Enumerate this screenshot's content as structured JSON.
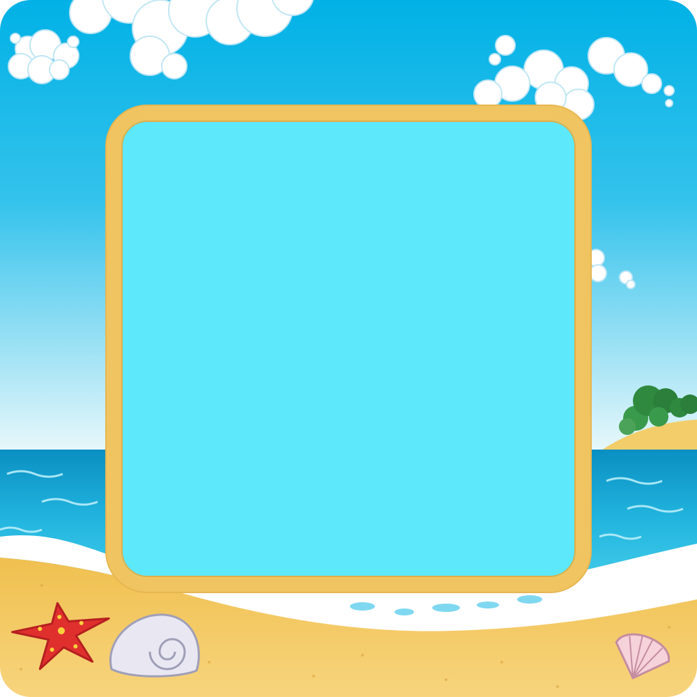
{
  "scene": {
    "theme": "cartoon beach photo frame",
    "colors": {
      "sky_top": "#01b1e6",
      "sky_bottom": "#e7f7fb",
      "sea": "#0fa6d4",
      "sand": "#f3c55d",
      "frame_border": "#f0c561",
      "frame_fill": "#5de8fc"
    },
    "icons": [
      "cloud-icon",
      "island-icon",
      "starfish-icon",
      "snail-shell-icon",
      "scallop-shell-icon"
    ]
  }
}
